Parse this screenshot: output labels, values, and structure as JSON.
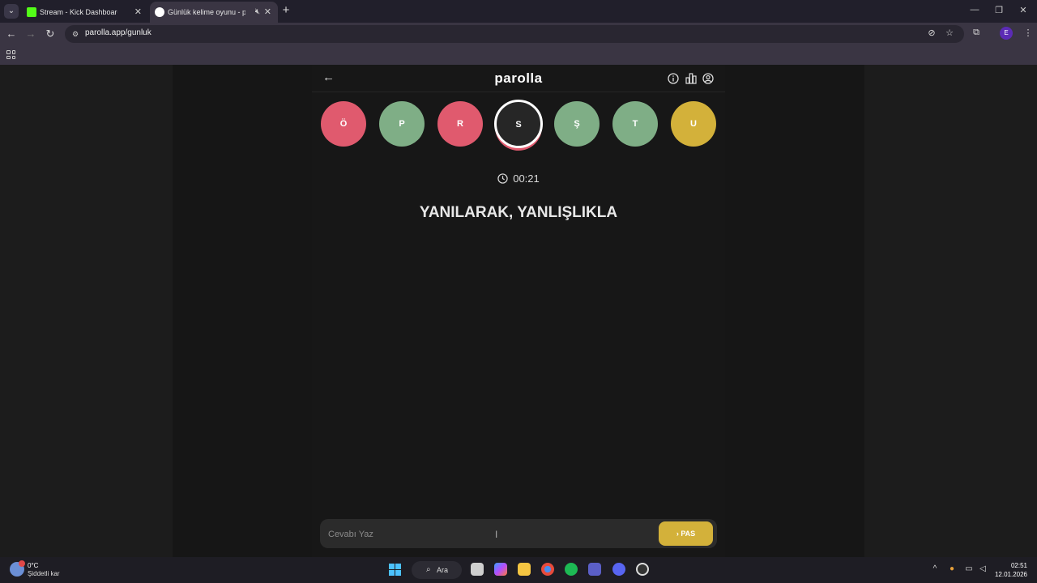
{
  "browser": {
    "tabs": [
      {
        "title": "Stream - Kick Dashboard",
        "favicon": "kick-icon",
        "favicon_color": "#53fc18",
        "active": false
      },
      {
        "title": "Günlük kelime oyunu - parolla",
        "favicon": "parolla-icon",
        "favicon_color": "#ffffff",
        "active": true
      }
    ],
    "url": "parolla.app/gunluk",
    "profile_initial": "E"
  },
  "game": {
    "logo": "parolla",
    "letters": [
      {
        "letter": "Ö",
        "state": "wrong",
        "color": "#e05a6e"
      },
      {
        "letter": "P",
        "state": "correct",
        "color": "#7fae86"
      },
      {
        "letter": "R",
        "state": "wrong",
        "color": "#e05a6e"
      },
      {
        "letter": "S",
        "state": "current",
        "color": "#262626"
      },
      {
        "letter": "Ş",
        "state": "correct",
        "color": "#7fae86"
      },
      {
        "letter": "T",
        "state": "correct",
        "color": "#7fae86"
      },
      {
        "letter": "U",
        "state": "passed",
        "color": "#d3b13a"
      }
    ],
    "timer": "00:21",
    "clue": "YANILARAK, YANLIŞLIKLA",
    "answer_placeholder": "Cevabı Yaz",
    "pass_label": "PAS"
  },
  "taskbar": {
    "weather_temp": "0°C",
    "weather_desc": "Şiddetli kar",
    "search_label": "Ara",
    "time": "02:51",
    "date": "12.01.2026"
  }
}
